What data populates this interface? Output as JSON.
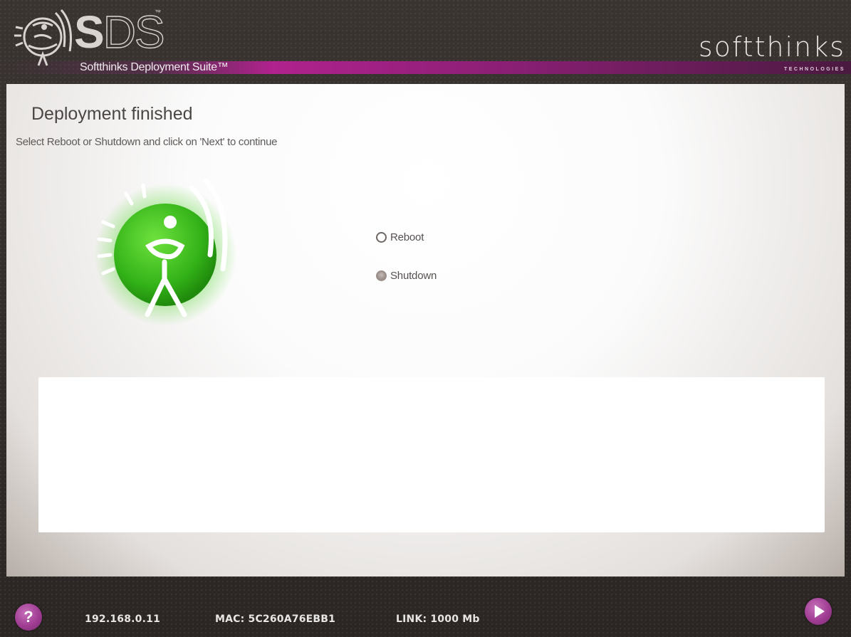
{
  "header": {
    "app_short": "DS",
    "app_short_bold": "S",
    "trademark": "™",
    "suite_name": "Softthinks Deployment Suite™",
    "brand": "softthinks",
    "brand_sub": "TECHNOLOGIES"
  },
  "main": {
    "title": "Deployment finished",
    "subtitle": "Select Reboot or Shutdown and click on 'Next' to continue",
    "options": [
      {
        "label": "Reboot",
        "selected": false
      },
      {
        "label": "Shutdown",
        "selected": true
      }
    ],
    "log_text": ""
  },
  "footer": {
    "help_label": "?",
    "ip": "192.168.0.11",
    "mac": "MAC: 5C260A76EBB1",
    "link": "LINK: 1000 Mb"
  },
  "colors": {
    "accent": "#a03d93",
    "success_green": "#3fbf1f",
    "header_band": "#b0228e"
  },
  "icons": {
    "logo": "sds-logo-icon",
    "success": "success-figure-icon",
    "help": "help-icon",
    "next": "play-next-icon"
  }
}
